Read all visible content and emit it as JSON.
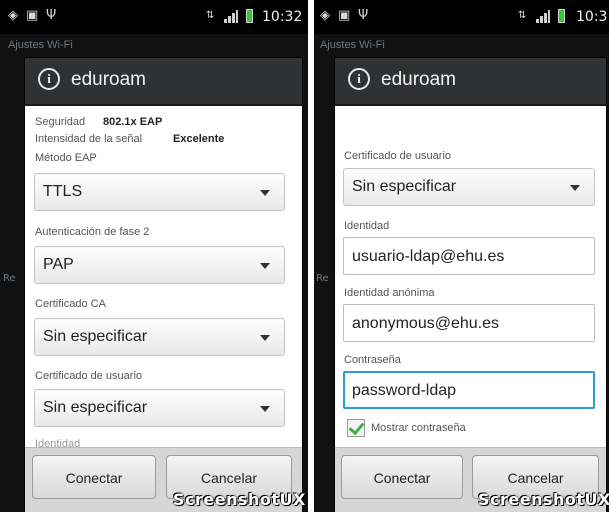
{
  "status_bar": {
    "time_left": "10:32",
    "time_right": "10:3"
  },
  "background": {
    "title": "Ajustes Wi-Fi",
    "row_letter": "Re"
  },
  "dialog": {
    "title": "eduroam",
    "info_icon_glyph": "i"
  },
  "left_panel": {
    "security_label": "Seguridad",
    "security_value": "802.1x EAP",
    "signal_label": "Intensidad de la señal",
    "signal_value": "Excelente",
    "eap_label": "Método EAP",
    "eap_value": "TTLS",
    "phase2_label": "Autenticación de fase 2",
    "phase2_value": "PAP",
    "ca_label": "Certificado CA",
    "ca_value": "Sin especificar",
    "user_cert_label": "Certificado de usuario",
    "user_cert_value": "Sin especificar",
    "identity_label_partial": "Identidad"
  },
  "right_panel": {
    "user_cert_label": "Certificado de usuario",
    "user_cert_value": "Sin especificar",
    "identity_label": "Identidad",
    "identity_value": "usuario-ldap@ehu.es",
    "anon_label": "Identidad anónima",
    "anon_value": "anonymous@ehu.es",
    "password_label": "Contraseña",
    "password_value": "password-ldap",
    "show_password_label": "Mostrar contraseña",
    "show_password_checked": true
  },
  "buttons": {
    "connect": "Conectar",
    "cancel": "Cancelar"
  },
  "watermark": "ScreenshotUX",
  "colors": {
    "accent_focus": "#2a9fd6",
    "check_green": "#3fb33f",
    "battery_green": "#33cc33",
    "title_bar": "#2f3133"
  }
}
